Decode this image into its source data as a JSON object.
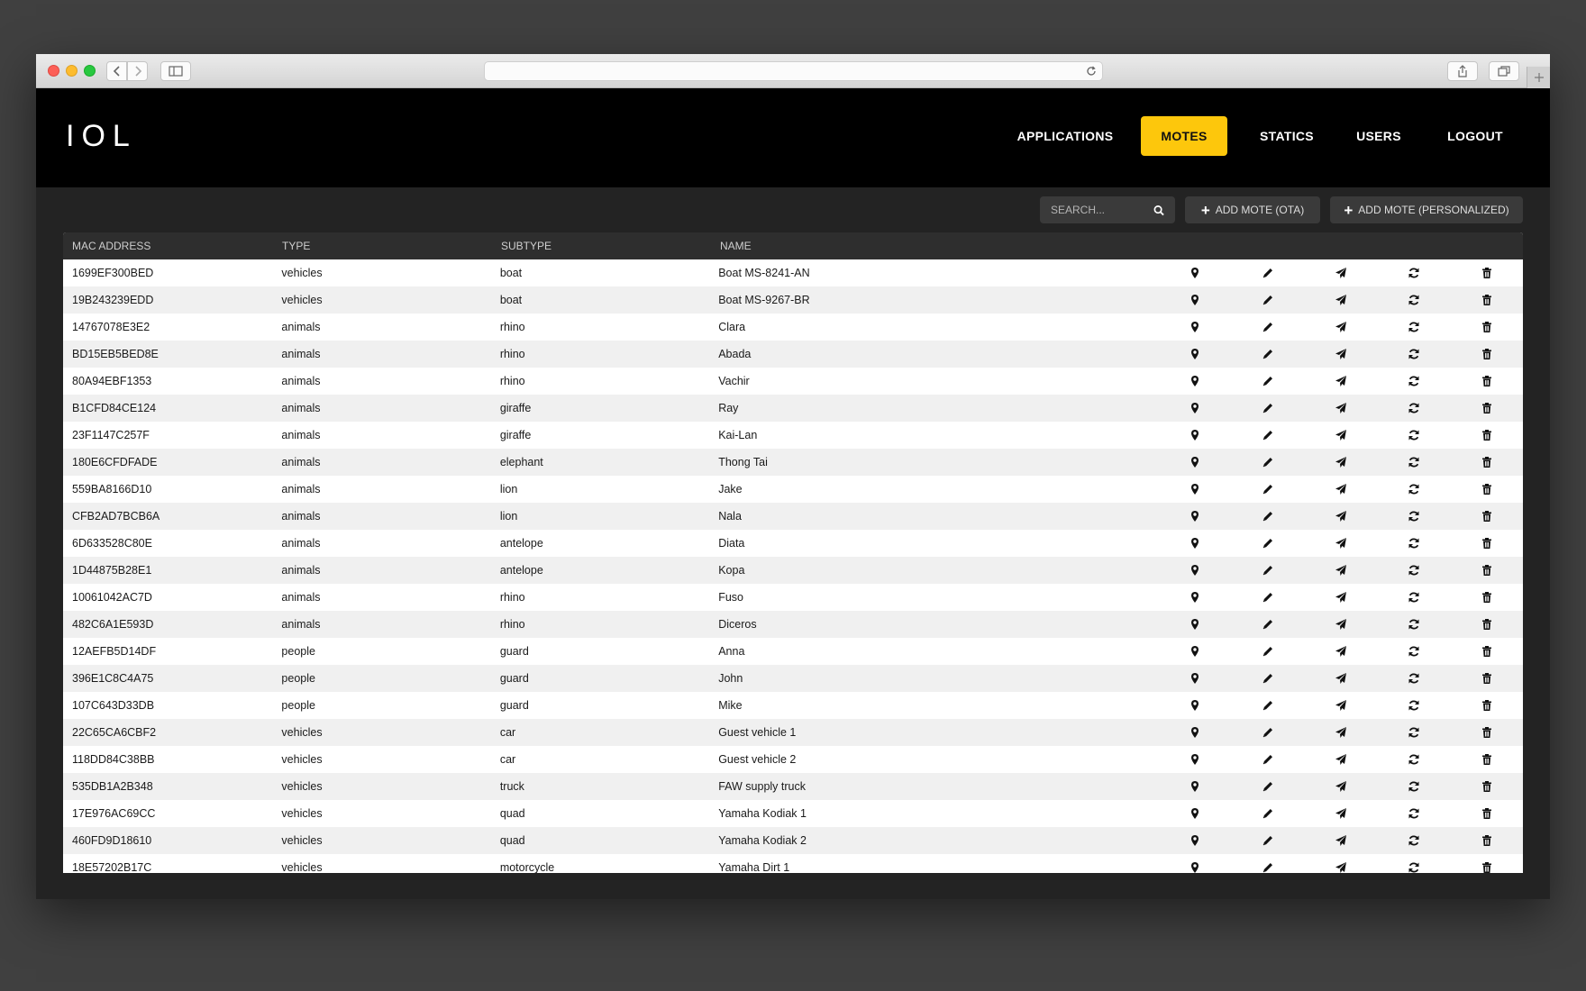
{
  "nav": {
    "logo": "IOL",
    "items": [
      {
        "label": "APPLICATIONS",
        "active": false
      },
      {
        "label": "MOTES",
        "active": true
      },
      {
        "label": "STATICS",
        "active": false
      },
      {
        "label": "USERS",
        "active": false
      },
      {
        "label": "LOGOUT",
        "active": false
      }
    ]
  },
  "toolbar": {
    "search_placeholder": "SEARCH...",
    "add_ota_label": "ADD MOTE (OTA)",
    "add_personalized_label": "ADD MOTE (PERSONALIZED)"
  },
  "table": {
    "columns": {
      "mac": "MAC ADDRESS",
      "type": "TYPE",
      "subtype": "SUBTYPE",
      "name": "NAME"
    },
    "action_icons": [
      "map-marker-icon",
      "pencil-icon",
      "send-icon",
      "refresh-icon",
      "trash-icon"
    ],
    "rows": [
      {
        "mac": "1699EF300BED",
        "type": "vehicles",
        "subtype": "boat",
        "name": "Boat MS-8241-AN"
      },
      {
        "mac": "19B243239EDD",
        "type": "vehicles",
        "subtype": "boat",
        "name": "Boat MS-9267-BR"
      },
      {
        "mac": "14767078E3E2",
        "type": "animals",
        "subtype": "rhino",
        "name": "Clara"
      },
      {
        "mac": "BD15EB5BED8E",
        "type": "animals",
        "subtype": "rhino",
        "name": "Abada"
      },
      {
        "mac": "80A94EBF1353",
        "type": "animals",
        "subtype": "rhino",
        "name": "Vachir"
      },
      {
        "mac": "B1CFD84CE124",
        "type": "animals",
        "subtype": "giraffe",
        "name": "Ray"
      },
      {
        "mac": "23F1147C257F",
        "type": "animals",
        "subtype": "giraffe",
        "name": "Kai-Lan"
      },
      {
        "mac": "180E6CFDFADE",
        "type": "animals",
        "subtype": "elephant",
        "name": "Thong Tai"
      },
      {
        "mac": "559BA8166D10",
        "type": "animals",
        "subtype": "lion",
        "name": "Jake"
      },
      {
        "mac": "CFB2AD7BCB6A",
        "type": "animals",
        "subtype": "lion",
        "name": "Nala"
      },
      {
        "mac": "6D633528C80E",
        "type": "animals",
        "subtype": "antelope",
        "name": "Diata"
      },
      {
        "mac": "1D44875B28E1",
        "type": "animals",
        "subtype": "antelope",
        "name": "Kopa"
      },
      {
        "mac": "10061042AC7D",
        "type": "animals",
        "subtype": "rhino",
        "name": "Fuso"
      },
      {
        "mac": "482C6A1E593D",
        "type": "animals",
        "subtype": "rhino",
        "name": "Diceros"
      },
      {
        "mac": "12AEFB5D14DF",
        "type": "people",
        "subtype": "guard",
        "name": "Anna"
      },
      {
        "mac": "396E1C8C4A75",
        "type": "people",
        "subtype": "guard",
        "name": "John"
      },
      {
        "mac": "107C643D33DB",
        "type": "people",
        "subtype": "guard",
        "name": "Mike"
      },
      {
        "mac": "22C65CA6CBF2",
        "type": "vehicles",
        "subtype": "car",
        "name": "Guest vehicle 1"
      },
      {
        "mac": "118DD84C38BB",
        "type": "vehicles",
        "subtype": "car",
        "name": "Guest vehicle 2"
      },
      {
        "mac": "535DB1A2B348",
        "type": "vehicles",
        "subtype": "truck",
        "name": "FAW supply truck"
      },
      {
        "mac": "17E976AC69CC",
        "type": "vehicles",
        "subtype": "quad",
        "name": "Yamaha Kodiak 1"
      },
      {
        "mac": "460FD9D18610",
        "type": "vehicles",
        "subtype": "quad",
        "name": "Yamaha Kodiak 2"
      },
      {
        "mac": "18E57202B17C",
        "type": "vehicles",
        "subtype": "motorcycle",
        "name": "Yamaha Dirt 1"
      }
    ]
  }
}
